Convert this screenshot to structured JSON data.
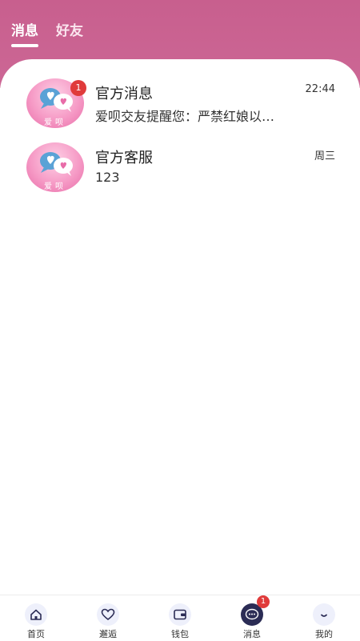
{
  "tabs": [
    {
      "label": "消息",
      "active": true
    },
    {
      "label": "好友",
      "active": false
    }
  ],
  "conversations": [
    {
      "title": "官方消息",
      "preview": "爱呗交友提醒您：严禁红娘以…",
      "time": "22:44",
      "unread": "1",
      "avatar_text": "爱呗"
    },
    {
      "title": "官方客服",
      "preview": "123",
      "time": "周三",
      "avatar_text": "爱呗"
    }
  ],
  "nav": [
    {
      "label": "首页",
      "icon": "home-icon"
    },
    {
      "label": "邂逅",
      "icon": "heart-icon"
    },
    {
      "label": "钱包",
      "icon": "wallet-icon"
    },
    {
      "label": "消息",
      "icon": "message-icon",
      "active": true,
      "badge": "1"
    },
    {
      "label": "我的",
      "icon": "profile-icon"
    }
  ],
  "colors": {
    "header": "#c85f8e",
    "badge": "#e03b3b",
    "active_nav": "#2b2c55"
  }
}
